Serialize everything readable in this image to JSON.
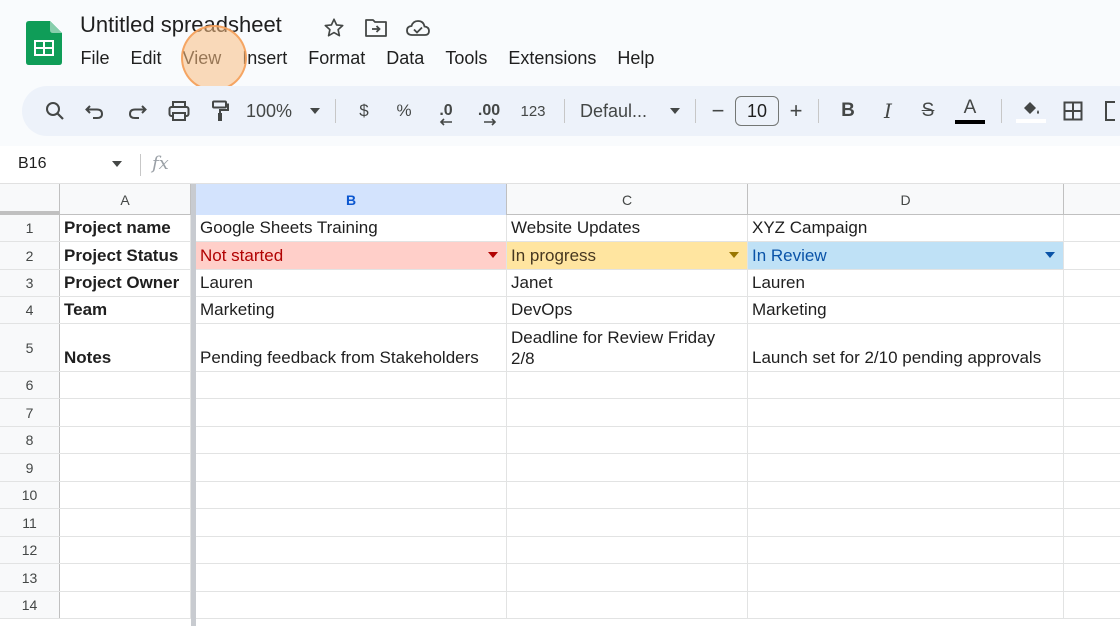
{
  "document": {
    "title": "Untitled spreadsheet",
    "title_icons": [
      "star-icon",
      "move-to-folder-icon",
      "cloud-status-icon"
    ]
  },
  "menu": [
    "File",
    "Edit",
    "View",
    "Insert",
    "Format",
    "Data",
    "Tools",
    "Extensions",
    "Help"
  ],
  "highlighted_menu": "View",
  "toolbar": {
    "zoom": "100%",
    "currency": "$",
    "percent": "%",
    "decrease_decimal": ".0",
    "increase_decimal": ".00",
    "number_format": "123",
    "font": "Defaul...",
    "font_size_minus": "−",
    "font_size": "10",
    "font_size_plus": "+",
    "bold": "B",
    "italic": "I",
    "strikethrough": "S",
    "text_color": "A",
    "text_color_underline": "#000000"
  },
  "formula_bar": {
    "cell_ref": "B16",
    "fx": "fx",
    "value": ""
  },
  "grid": {
    "selected_column": "B",
    "columns": [
      "A",
      "B",
      "C",
      "D"
    ],
    "rows": [
      {
        "num": "1",
        "cells": [
          "Project name",
          "Google Sheets Training",
          "Website Updates",
          "XYZ Campaign"
        ]
      },
      {
        "num": "2",
        "cells": [
          "Project Status",
          "Not started",
          "In progress",
          "In Review"
        ]
      },
      {
        "num": "3",
        "cells": [
          "Project Owner",
          "Lauren",
          "Janet",
          "Lauren"
        ]
      },
      {
        "num": "4",
        "cells": [
          "Team",
          "Marketing",
          "DevOps",
          "Marketing"
        ]
      },
      {
        "num": "5",
        "cells": [
          "Notes",
          "Pending feedback from Stakeholders",
          "Deadline for Review Friday 2/8",
          "Launch set for 2/10 pending approvals"
        ]
      },
      {
        "num": "6",
        "cells": [
          "",
          "",
          "",
          ""
        ]
      },
      {
        "num": "7",
        "cells": [
          "",
          "",
          "",
          ""
        ]
      },
      {
        "num": "8",
        "cells": [
          "",
          "",
          "",
          ""
        ]
      },
      {
        "num": "9",
        "cells": [
          "",
          "",
          "",
          ""
        ]
      },
      {
        "num": "10",
        "cells": [
          "",
          "",
          "",
          ""
        ]
      },
      {
        "num": "11",
        "cells": [
          "",
          "",
          "",
          ""
        ]
      },
      {
        "num": "12",
        "cells": [
          "",
          "",
          "",
          ""
        ]
      },
      {
        "num": "13",
        "cells": [
          "",
          "",
          "",
          ""
        ]
      },
      {
        "num": "14",
        "cells": [
          "",
          "",
          "",
          ""
        ]
      }
    ],
    "status_colors": {
      "Not started": "#ffcfc9",
      "In progress": "#ffe5a0",
      "In Review": "#bfe1f6"
    }
  },
  "colors": {
    "brand_green": "#0f9d58",
    "selected_header": "#d3e3fd",
    "toolbar_bg": "#edf2fa"
  }
}
